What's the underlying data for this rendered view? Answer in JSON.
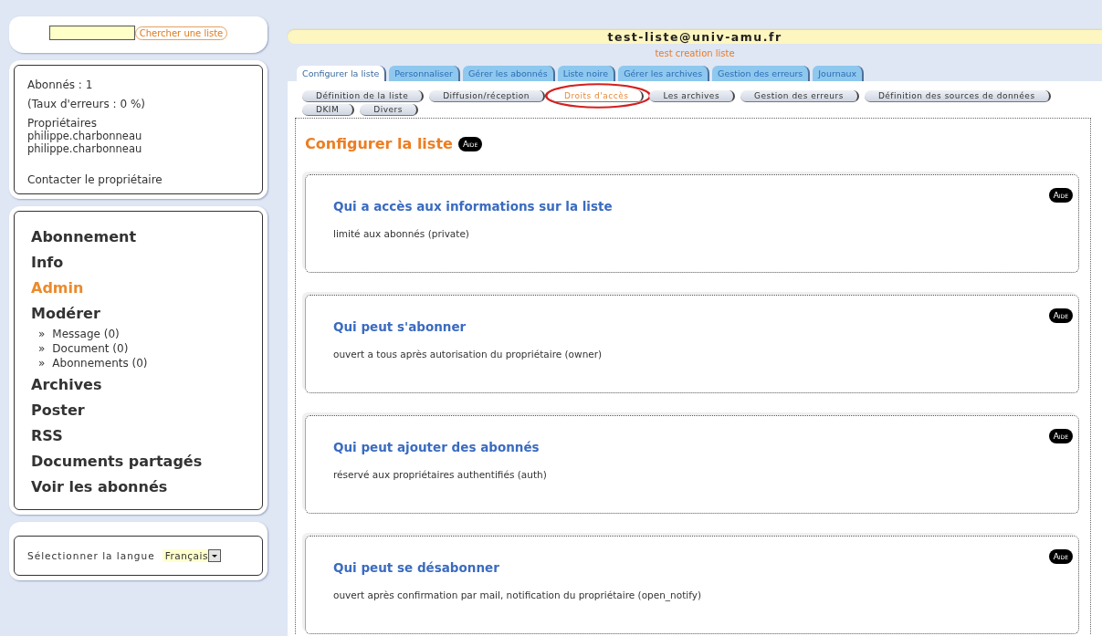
{
  "search": {
    "button": "Chercher une liste"
  },
  "info": {
    "subscribers": "Abonnés : 1",
    "error_rate": "(Taux d'erreurs : 0 %)",
    "owners_label": "Propriétaires",
    "owners": [
      "philippe.charbonneau",
      "philippe.charbonneau"
    ],
    "contact": "Contacter le propriétaire"
  },
  "menu": [
    {
      "label": "Abonnement",
      "selected": false
    },
    {
      "label": "Info",
      "selected": false
    },
    {
      "label": "Admin",
      "selected": true
    },
    {
      "label": "Modérer",
      "selected": false,
      "children": [
        {
          "bullet": "»",
          "label": "Message (0)"
        },
        {
          "bullet": "»",
          "label": "Document (0)"
        },
        {
          "bullet": "»",
          "label": "Abonnements (0)"
        }
      ]
    },
    {
      "label": "Archives",
      "selected": false
    },
    {
      "label": "Poster",
      "selected": false
    },
    {
      "label": "RSS",
      "selected": false
    },
    {
      "label": "Documents partagés",
      "selected": false
    },
    {
      "label": "Voir les abonnés",
      "selected": false
    }
  ],
  "language": {
    "label": "Sélectionner la langue",
    "value": "Français"
  },
  "list": {
    "address": "test-liste@univ-amu.fr",
    "subtitle": "test creation liste"
  },
  "tabs": [
    {
      "label": "Configurer la liste",
      "selected": true
    },
    {
      "label": "Personnaliser",
      "selected": false
    },
    {
      "label": "Gérer les abonnés",
      "selected": false
    },
    {
      "label": "Liste noire",
      "selected": false
    },
    {
      "label": "Gérer les archives",
      "selected": false
    },
    {
      "label": "Gestion des erreurs",
      "selected": false
    },
    {
      "label": "Journaux",
      "selected": false
    }
  ],
  "subtabs": [
    {
      "label": "Définition de la liste",
      "selected": false,
      "circled": false
    },
    {
      "label": "Diffusion/réception",
      "selected": false,
      "circled": false
    },
    {
      "label": "Droits d'accès",
      "selected": true,
      "circled": true
    },
    {
      "label": "Les archives",
      "selected": false,
      "circled": false
    },
    {
      "label": "Gestion des erreurs",
      "selected": false,
      "circled": false
    },
    {
      "label": "Définition des sources de données",
      "selected": false,
      "circled": false
    },
    {
      "label": "DKIM",
      "selected": false,
      "circled": false
    },
    {
      "label": "Divers",
      "selected": false,
      "circled": false
    }
  ],
  "heading": {
    "title": "Configurer la liste",
    "help": "Aide"
  },
  "sections": [
    {
      "title": "Qui a accès aux informations sur la liste",
      "value": "limité aux abonnés (private)",
      "help": "Aide"
    },
    {
      "title": "Qui peut s'abonner",
      "value": "ouvert a tous après autorisation du propriétaire (owner)",
      "help": "Aide"
    },
    {
      "title": "Qui peut ajouter des abonnés",
      "value": "réservé aux propriétaires authentifiés (auth)",
      "help": "Aide"
    },
    {
      "title": "Qui peut se désabonner",
      "value": "ouvert après confirmation par mail, notification du propriétaire (open_notify)",
      "help": "Aide"
    }
  ]
}
